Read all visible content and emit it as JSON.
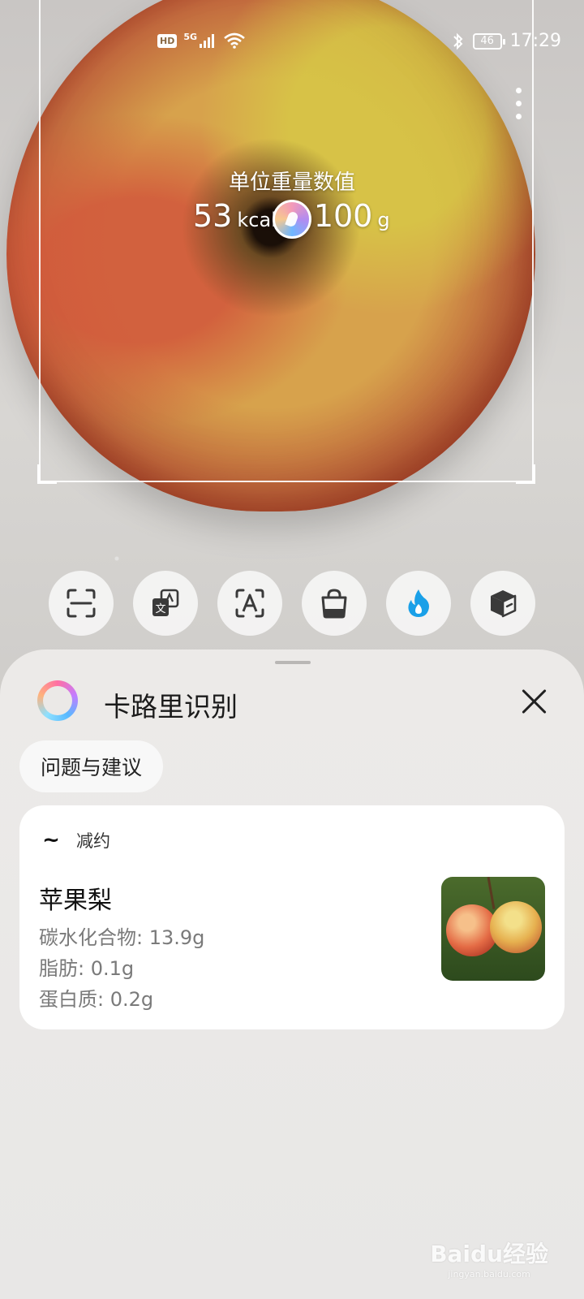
{
  "status": {
    "hd": "HD",
    "network": "5G",
    "battery": "46",
    "time": "17:29"
  },
  "overlay": {
    "title": "单位重量数值",
    "kcal_value": "53",
    "kcal_unit": "kcal",
    "weight_value": "100",
    "weight_unit": "g"
  },
  "modes": [
    {
      "icon": "scan-icon",
      "active": false
    },
    {
      "icon": "translate-icon",
      "active": false
    },
    {
      "icon": "text-recognize-icon",
      "active": false
    },
    {
      "icon": "shopping-bag-icon",
      "active": false
    },
    {
      "icon": "calorie-flame-icon",
      "active": true,
      "color": "#1aa0e8"
    },
    {
      "icon": "package-box-icon",
      "active": false
    }
  ],
  "sheet": {
    "title": "卡路里识别",
    "feedback_label": "问题与建议"
  },
  "result_card": {
    "brand_icon": "~",
    "brand_name": "减约",
    "food_name": "苹果梨",
    "carbs": "碳水化合物: 13.9g",
    "fat": "脂肪: 0.1g",
    "protein": "蛋白质: 0.2g"
  },
  "watermark": {
    "logo_text": "Baidu经验",
    "sub_text": "jingyan.baidu.com"
  }
}
